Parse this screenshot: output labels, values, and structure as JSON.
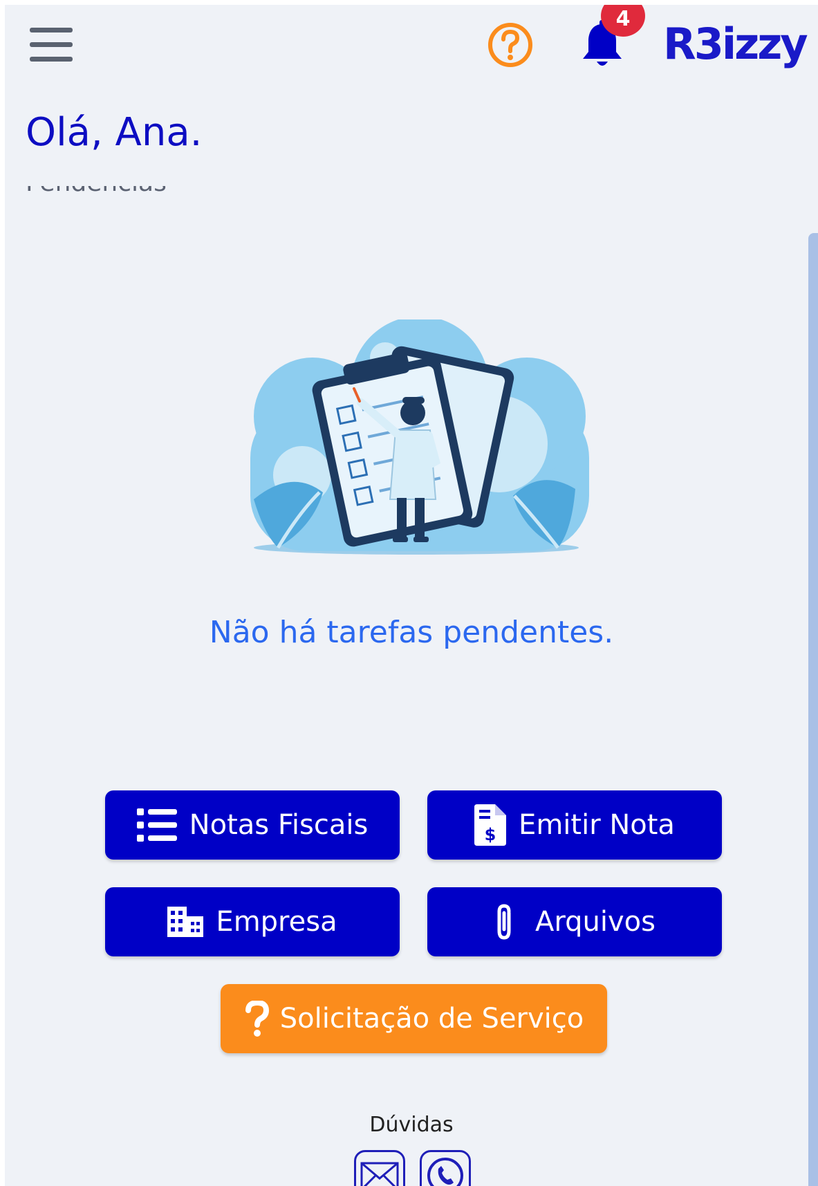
{
  "header": {
    "menu_icon": "hamburger-menu-icon",
    "help_icon": "question-circle-icon",
    "notifications_icon": "bell-icon",
    "notification_count": "4",
    "logo_text": "R3izzy",
    "colors": {
      "help": "#fb8c1c",
      "bell": "#0000c6",
      "badge": "#e02a3c",
      "logo": "#1a1ac8"
    }
  },
  "greeting": "Olá, Ana.",
  "section_title_partial": "Pendências",
  "empty_state": {
    "message": "Não há tarefas pendentes.",
    "illustration": "clipboard-checklist-illustration"
  },
  "actions": {
    "notas_fiscais": {
      "label": "Notas Fiscais",
      "icon": "list-icon"
    },
    "emitir_nota": {
      "label": "Emitir Nota",
      "icon": "file-invoice-dollar-icon"
    },
    "empresa": {
      "label": "Empresa",
      "icon": "building-icon"
    },
    "arquivos": {
      "label": "Arquivos",
      "icon": "paperclip-icon"
    },
    "solicitacao": {
      "label": "Solicitação de Serviço",
      "icon": "question-mark-icon"
    }
  },
  "footer": {
    "doubts_label": "Dúvidas",
    "email_icon": "envelope-icon",
    "whatsapp_icon": "whatsapp-icon"
  },
  "theme": {
    "primary": "#0000c6",
    "accent": "#fb8c1c",
    "background": "#eff2f7",
    "message": "#2b68ef"
  }
}
